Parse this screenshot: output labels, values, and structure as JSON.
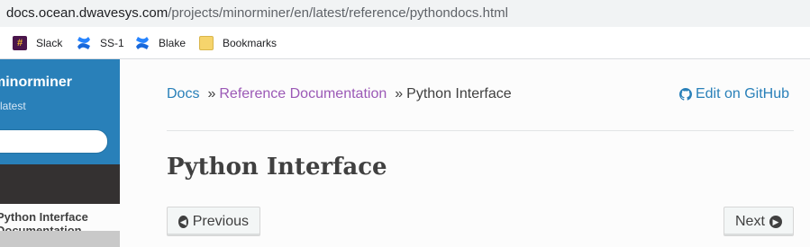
{
  "browser": {
    "url_host": "docs.ocean.dwavesys.com",
    "url_path": "/projects/minorminer/en/latest/reference/pythondocs.html"
  },
  "bookmarks": [
    {
      "label": "Slack",
      "icon": "slack-icon"
    },
    {
      "label": "SS-1",
      "icon": "confluence-icon"
    },
    {
      "label": "Blake",
      "icon": "confluence-icon"
    },
    {
      "label": "Bookmarks",
      "icon": "folder-icon"
    }
  ],
  "sidebar": {
    "project_title": "minorminer",
    "version": "latest",
    "search_placeholder": "",
    "current_item": "Python Interface Documentation"
  },
  "breadcrumbs": {
    "home": "Docs",
    "sep": "»",
    "parent": "Reference Documentation",
    "current": "Python Interface"
  },
  "github": {
    "label": "Edit on GitHub",
    "icon": "github-icon"
  },
  "page": {
    "title": "Python Interface"
  },
  "nav": {
    "previous": "Previous",
    "next": "Next"
  },
  "colors": {
    "sidebar_blue": "#2980b9",
    "link": "#2980b9",
    "visited_link": "#9b59b6",
    "text": "#404040"
  }
}
